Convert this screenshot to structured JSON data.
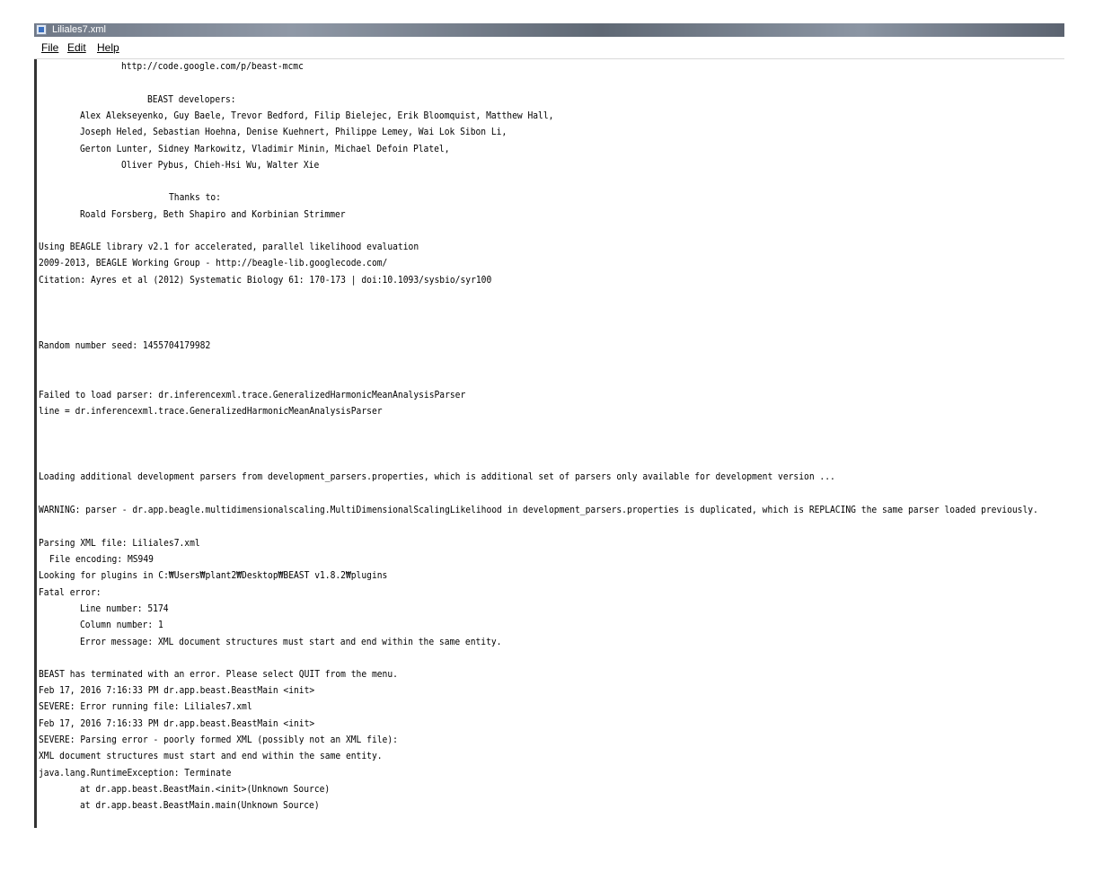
{
  "window": {
    "title": "Liliales7.xml",
    "icon": "app-window-icon"
  },
  "menu": {
    "file": "File",
    "edit": "Edit",
    "help": "Help"
  },
  "console": {
    "lines": [
      "http://code.google.com/p/beast-mcmc",
      "BEAST developers:",
      "Alex Alekseyenko, Guy Baele, Trevor Bedford, Filip Bielejec, Erik Bloomquist, Matthew Hall,",
      "Joseph Heled, Sebastian Hoehna, Denise Kuehnert, Philippe Lemey, Wai Lok Sibon Li,",
      "Gerton Lunter, Sidney Markowitz, Vladimir Minin, Michael Defoin Platel,",
      "Oliver Pybus, Chieh-Hsi Wu, Walter Xie",
      "Thanks to:",
      "Roald Forsberg, Beth Shapiro and Korbinian Strimmer",
      "Using BEAGLE library v2.1 for accelerated, parallel likelihood evaluation",
      "2009-2013, BEAGLE Working Group - http://beagle-lib.googlecode.com/",
      "Citation: Ayres et al (2012) Systematic Biology 61: 170-173 | doi:10.1093/sysbio/syr100",
      "Random number seed: 1455704179982",
      "Failed to load parser: dr.inferencexml.trace.GeneralizedHarmonicMeanAnalysisParser",
      "line = dr.inferencexml.trace.GeneralizedHarmonicMeanAnalysisParser",
      "Loading additional development parsers from development_parsers.properties, which is additional set of parsers only available for development version ...",
      "WARNING: parser - dr.app.beagle.multidimensionalscaling.MultiDimensionalScalingLikelihood in development_parsers.properties is duplicated, which is REPLACING the same parser loaded previously.",
      "Parsing XML file: Liliales7.xml",
      "File encoding: MS949",
      "Looking for plugins in C:₩Users₩plant2₩Desktop₩BEAST v1.8.2₩plugins",
      "Fatal error:",
      "Line number: 5174",
      "Column number: 1",
      "Error message: XML document structures must start and end within the same entity.",
      "BEAST has terminated with an error. Please select QUIT from the menu.",
      "Feb 17, 2016 7:16:33 PM dr.app.beast.BeastMain <init>",
      "SEVERE: Error running file: Liliales7.xml",
      "Feb 17, 2016 7:16:33 PM dr.app.beast.BeastMain <init>",
      "SEVERE: Parsing error - poorly formed XML (possibly not an XML file):",
      "XML document structures must start and end within the same entity.",
      "java.lang.RuntimeException: Terminate",
      "at dr.app.beast.BeastMain.<init>(Unknown Source)",
      "at dr.app.beast.BeastMain.main(Unknown Source)"
    ]
  }
}
